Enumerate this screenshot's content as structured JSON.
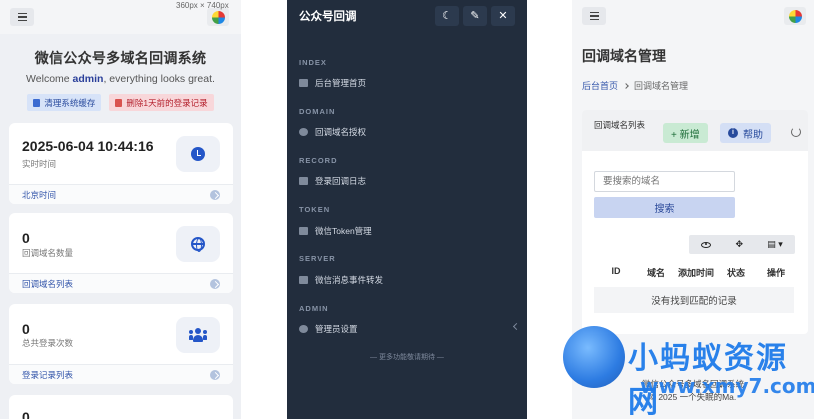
{
  "dashboard": {
    "size_caption": "360px × 740px",
    "title": "微信公众号多域名回调系统",
    "welcome_prefix": "Welcome ",
    "welcome_user": "admin",
    "welcome_suffix": ", everything looks great.",
    "clear_cache_label": "清理系统缓存",
    "delete_logs_label": "删除1天前的登录记录",
    "cards": [
      {
        "value": "2025-06-04 10:44:16",
        "label": "实时时间",
        "footer": "北京时间",
        "icon": "clock-icon"
      },
      {
        "value": "0",
        "label": "回调域名数量",
        "footer": "回调域名列表",
        "icon": "globe-icon"
      },
      {
        "value": "0",
        "label": "总共登录次数",
        "footer": "登录记录列表",
        "icon": "users-icon"
      },
      {
        "value": "0"
      }
    ]
  },
  "sidebar": {
    "brand": "公众号回调",
    "sections": [
      {
        "heading": "INDEX",
        "item": "后台管理首页",
        "icon": "home-icon"
      },
      {
        "heading": "DOMAIN",
        "item": "回调域名授权",
        "icon": "globe-icon"
      },
      {
        "heading": "RECORD",
        "item": "登录回调日志",
        "icon": "list-icon"
      },
      {
        "heading": "TOKEN",
        "item": "微信Token管理",
        "icon": "key-icon"
      },
      {
        "heading": "SERVER",
        "item": "微信消息事件转发",
        "icon": "server-icon"
      },
      {
        "heading": "ADMIN",
        "item": "管理员设置",
        "icon": "gear-icon"
      }
    ],
    "more": "— 更多功能敬请期待 —"
  },
  "domains": {
    "title": "回调域名管理",
    "breadcrumb_home": "后台首页",
    "breadcrumb_current": "回调域名管理",
    "panel_title": "回调域名列表",
    "add_label": "+ 新增",
    "help_label": "帮助",
    "search_placeholder": "要搜索的域名",
    "search_label": "搜索",
    "columns": [
      "ID",
      "域名",
      "添加时间",
      "状态",
      "操作"
    ],
    "empty_text": "没有找到匹配的记录",
    "footer_line1": "微信公众号多域名回调系统",
    "footer_line2": "© 2025 一个失眠的Ma."
  },
  "watermark": {
    "text": "小蚂蚁资源网",
    "url": "www.xmy7.com"
  }
}
